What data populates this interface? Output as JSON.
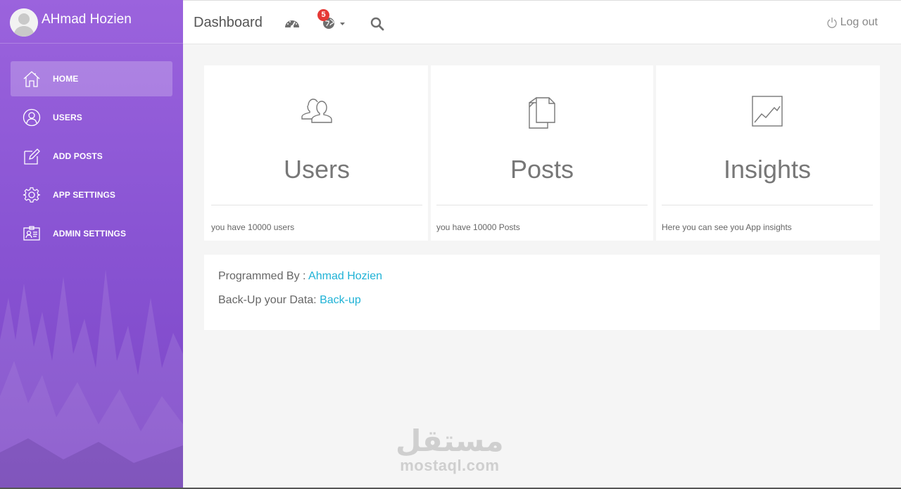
{
  "sidebar": {
    "user_name": "AHmad Hozien",
    "items": [
      {
        "label": "HOME",
        "icon": "home-icon",
        "active": true
      },
      {
        "label": "USERS",
        "icon": "user-icon",
        "active": false
      },
      {
        "label": "ADD POSTS",
        "icon": "edit-icon",
        "active": false
      },
      {
        "label": "APP SETTINGS",
        "icon": "gear-icon",
        "active": false
      },
      {
        "label": "ADMIN SETTINGS",
        "icon": "id-card-icon",
        "active": false
      }
    ]
  },
  "topbar": {
    "title": "Dashboard",
    "notification_count": "5",
    "logout_label": "Log out",
    "icons": [
      "dashboard-gauge-icon",
      "globe-icon",
      "search-icon",
      "power-icon"
    ]
  },
  "cards": [
    {
      "title": "Users",
      "footer": "you have 10000 users",
      "icon": "users-icon"
    },
    {
      "title": "Posts",
      "footer": "you have 10000 Posts",
      "icon": "documents-icon"
    },
    {
      "title": "Insights",
      "footer": "Here you can see you App insights",
      "icon": "line-chart-icon"
    }
  ],
  "info": {
    "programmed_by_label": "Programmed By : ",
    "programmed_by_link": "Ahmad Hozien",
    "backup_label": "Back-Up your Data: ",
    "backup_link": "Back-up"
  },
  "watermark": {
    "arabic": "مستقل",
    "latin": "mostaql.com"
  },
  "colors": {
    "sidebar": "#8a55d4",
    "link": "#1fb2d6",
    "badge": "#e53935"
  }
}
